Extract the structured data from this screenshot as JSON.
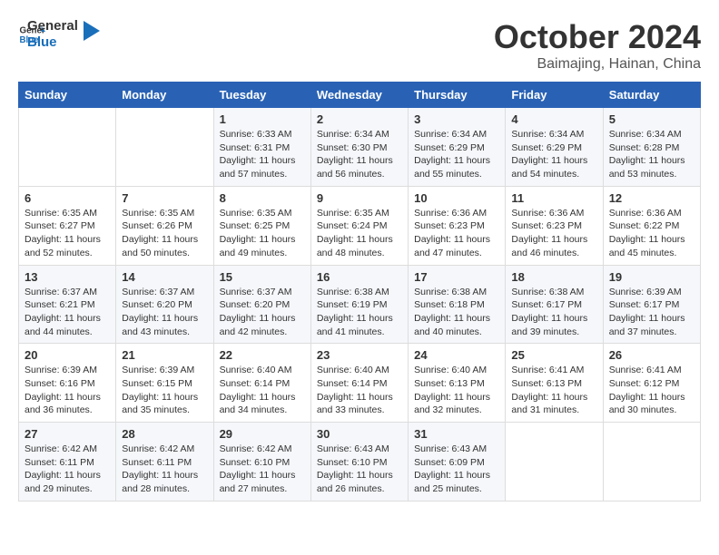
{
  "header": {
    "logo_general": "General",
    "logo_blue": "Blue",
    "month_title": "October 2024",
    "location": "Baimajing, Hainan, China"
  },
  "weekdays": [
    "Sunday",
    "Monday",
    "Tuesday",
    "Wednesday",
    "Thursday",
    "Friday",
    "Saturday"
  ],
  "weeks": [
    [
      {
        "day": "",
        "info": ""
      },
      {
        "day": "",
        "info": ""
      },
      {
        "day": "1",
        "info": "Sunrise: 6:33 AM\nSunset: 6:31 PM\nDaylight: 11 hours\nand 57 minutes."
      },
      {
        "day": "2",
        "info": "Sunrise: 6:34 AM\nSunset: 6:30 PM\nDaylight: 11 hours\nand 56 minutes."
      },
      {
        "day": "3",
        "info": "Sunrise: 6:34 AM\nSunset: 6:29 PM\nDaylight: 11 hours\nand 55 minutes."
      },
      {
        "day": "4",
        "info": "Sunrise: 6:34 AM\nSunset: 6:29 PM\nDaylight: 11 hours\nand 54 minutes."
      },
      {
        "day": "5",
        "info": "Sunrise: 6:34 AM\nSunset: 6:28 PM\nDaylight: 11 hours\nand 53 minutes."
      }
    ],
    [
      {
        "day": "6",
        "info": "Sunrise: 6:35 AM\nSunset: 6:27 PM\nDaylight: 11 hours\nand 52 minutes."
      },
      {
        "day": "7",
        "info": "Sunrise: 6:35 AM\nSunset: 6:26 PM\nDaylight: 11 hours\nand 50 minutes."
      },
      {
        "day": "8",
        "info": "Sunrise: 6:35 AM\nSunset: 6:25 PM\nDaylight: 11 hours\nand 49 minutes."
      },
      {
        "day": "9",
        "info": "Sunrise: 6:35 AM\nSunset: 6:24 PM\nDaylight: 11 hours\nand 48 minutes."
      },
      {
        "day": "10",
        "info": "Sunrise: 6:36 AM\nSunset: 6:23 PM\nDaylight: 11 hours\nand 47 minutes."
      },
      {
        "day": "11",
        "info": "Sunrise: 6:36 AM\nSunset: 6:23 PM\nDaylight: 11 hours\nand 46 minutes."
      },
      {
        "day": "12",
        "info": "Sunrise: 6:36 AM\nSunset: 6:22 PM\nDaylight: 11 hours\nand 45 minutes."
      }
    ],
    [
      {
        "day": "13",
        "info": "Sunrise: 6:37 AM\nSunset: 6:21 PM\nDaylight: 11 hours\nand 44 minutes."
      },
      {
        "day": "14",
        "info": "Sunrise: 6:37 AM\nSunset: 6:20 PM\nDaylight: 11 hours\nand 43 minutes."
      },
      {
        "day": "15",
        "info": "Sunrise: 6:37 AM\nSunset: 6:20 PM\nDaylight: 11 hours\nand 42 minutes."
      },
      {
        "day": "16",
        "info": "Sunrise: 6:38 AM\nSunset: 6:19 PM\nDaylight: 11 hours\nand 41 minutes."
      },
      {
        "day": "17",
        "info": "Sunrise: 6:38 AM\nSunset: 6:18 PM\nDaylight: 11 hours\nand 40 minutes."
      },
      {
        "day": "18",
        "info": "Sunrise: 6:38 AM\nSunset: 6:17 PM\nDaylight: 11 hours\nand 39 minutes."
      },
      {
        "day": "19",
        "info": "Sunrise: 6:39 AM\nSunset: 6:17 PM\nDaylight: 11 hours\nand 37 minutes."
      }
    ],
    [
      {
        "day": "20",
        "info": "Sunrise: 6:39 AM\nSunset: 6:16 PM\nDaylight: 11 hours\nand 36 minutes."
      },
      {
        "day": "21",
        "info": "Sunrise: 6:39 AM\nSunset: 6:15 PM\nDaylight: 11 hours\nand 35 minutes."
      },
      {
        "day": "22",
        "info": "Sunrise: 6:40 AM\nSunset: 6:14 PM\nDaylight: 11 hours\nand 34 minutes."
      },
      {
        "day": "23",
        "info": "Sunrise: 6:40 AM\nSunset: 6:14 PM\nDaylight: 11 hours\nand 33 minutes."
      },
      {
        "day": "24",
        "info": "Sunrise: 6:40 AM\nSunset: 6:13 PM\nDaylight: 11 hours\nand 32 minutes."
      },
      {
        "day": "25",
        "info": "Sunrise: 6:41 AM\nSunset: 6:13 PM\nDaylight: 11 hours\nand 31 minutes."
      },
      {
        "day": "26",
        "info": "Sunrise: 6:41 AM\nSunset: 6:12 PM\nDaylight: 11 hours\nand 30 minutes."
      }
    ],
    [
      {
        "day": "27",
        "info": "Sunrise: 6:42 AM\nSunset: 6:11 PM\nDaylight: 11 hours\nand 29 minutes."
      },
      {
        "day": "28",
        "info": "Sunrise: 6:42 AM\nSunset: 6:11 PM\nDaylight: 11 hours\nand 28 minutes."
      },
      {
        "day": "29",
        "info": "Sunrise: 6:42 AM\nSunset: 6:10 PM\nDaylight: 11 hours\nand 27 minutes."
      },
      {
        "day": "30",
        "info": "Sunrise: 6:43 AM\nSunset: 6:10 PM\nDaylight: 11 hours\nand 26 minutes."
      },
      {
        "day": "31",
        "info": "Sunrise: 6:43 AM\nSunset: 6:09 PM\nDaylight: 11 hours\nand 25 minutes."
      },
      {
        "day": "",
        "info": ""
      },
      {
        "day": "",
        "info": ""
      }
    ]
  ]
}
